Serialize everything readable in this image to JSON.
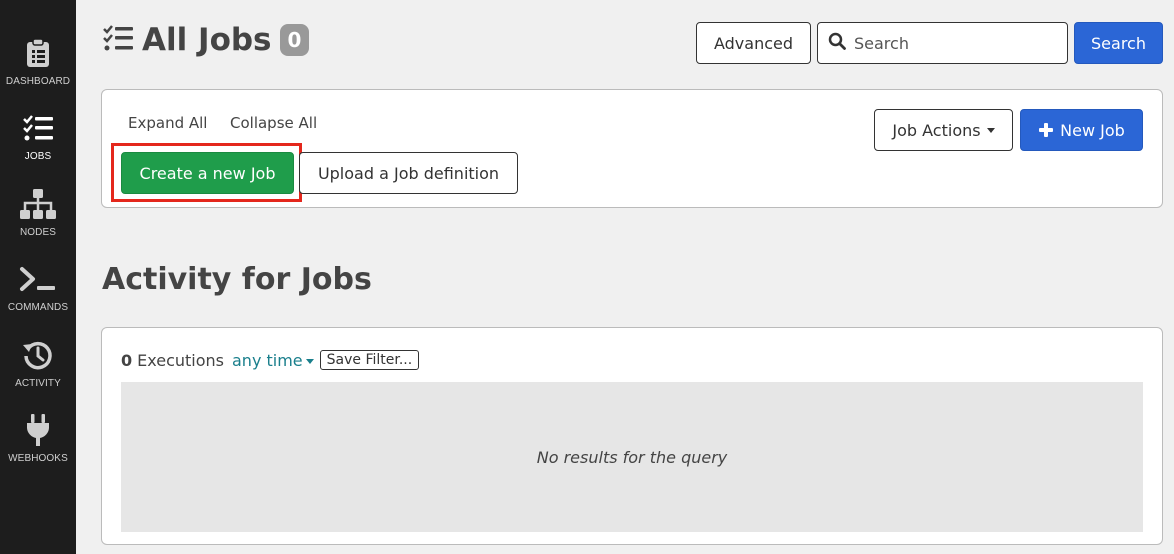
{
  "sidebar": {
    "items": [
      {
        "label": "DASHBOARD",
        "icon": "clipboard-icon"
      },
      {
        "label": "JOBS",
        "icon": "checklist-icon"
      },
      {
        "label": "NODES",
        "icon": "sitemap-icon"
      },
      {
        "label": "COMMANDS",
        "icon": "terminal-icon"
      },
      {
        "label": "ACTIVITY",
        "icon": "history-icon"
      },
      {
        "label": "WEBHOOKS",
        "icon": "plug-icon"
      }
    ]
  },
  "header": {
    "title": "All Jobs",
    "count": "0",
    "advanced_label": "Advanced",
    "search_placeholder": "Search",
    "search_button_label": "Search"
  },
  "job_panel": {
    "expand_all": "Expand All",
    "collapse_all": "Collapse All",
    "create_job_label": "Create a new Job",
    "upload_job_label": "Upload a Job definition",
    "job_actions_label": "Job Actions",
    "new_job_label": "New Job"
  },
  "activity": {
    "title": "Activity for Jobs",
    "executions_count": "0",
    "executions_label": "Executions",
    "time_filter": "any time",
    "save_filter_label": "Save Filter...",
    "empty_message": "No results for the query"
  },
  "colors": {
    "sidebar_bg": "#1d1d1d",
    "primary": "#2b66d6",
    "success": "#1f9d4b",
    "highlight": "#e4271c",
    "link_teal": "#1a7f8c"
  }
}
